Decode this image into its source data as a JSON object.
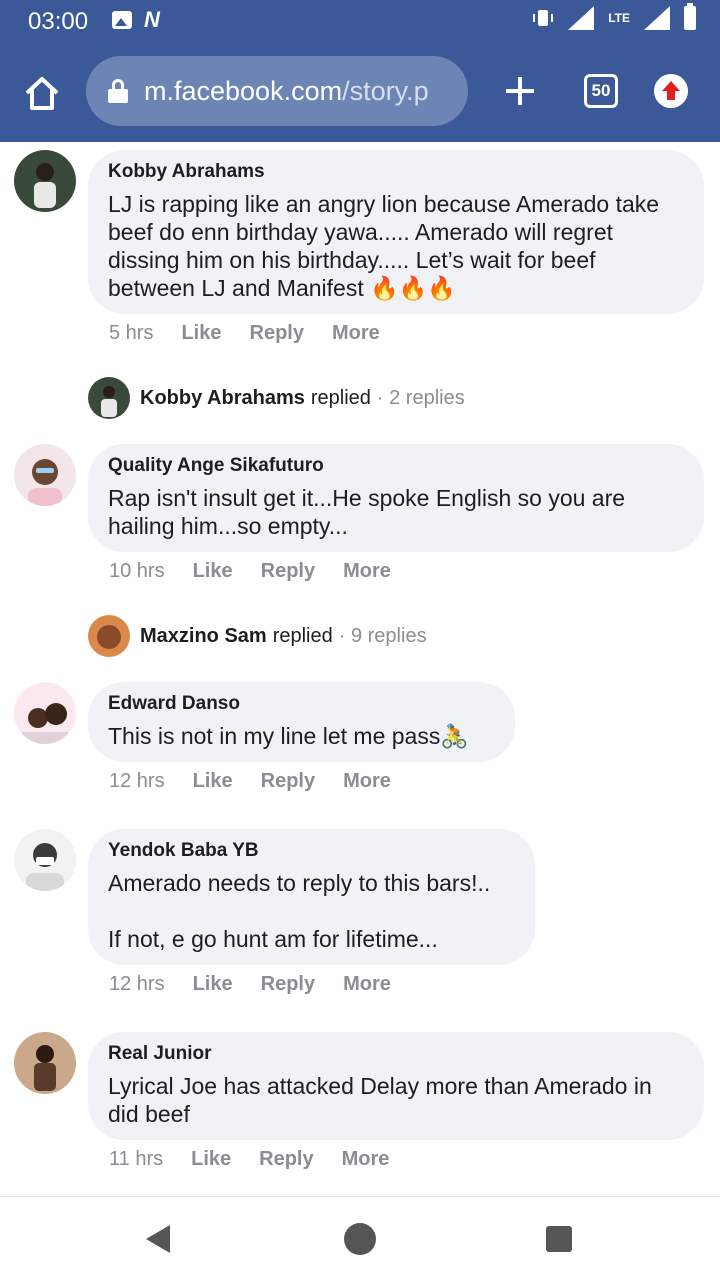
{
  "status": {
    "time": "03:00",
    "network": "LTE"
  },
  "browser": {
    "url_main": "m.facebook.com",
    "url_path": "/story.p",
    "tab_count": "50"
  },
  "comments": [
    {
      "author": "Kobby Abrahams",
      "text": "LJ is rapping like an angry lion because Amerado take beef do enn birthday yawa..... Amerado will regret dissing him on his birthday..... Let’s wait for beef between LJ and Manifest 🔥🔥🔥",
      "time": "5 hrs",
      "replied": {
        "author": "Kobby Abrahams",
        "verb": "replied",
        "count": "· 2 replies"
      }
    },
    {
      "author": "Quality Ange Sikafuturo",
      "text": "Rap isn't insult get it...He spoke English so you are hailing him...so empty...",
      "time": "10 hrs",
      "replied": {
        "author": "Maxzino Sam",
        "verb": "replied",
        "count": "· 9 replies"
      }
    },
    {
      "author": "Edward Danso",
      "text": "This is not in my line let me pass🚴",
      "time": "12 hrs"
    },
    {
      "author": "Yendok Baba YB",
      "text": "Amerado needs to reply to this bars!..\n\nIf not, e go hunt am for lifetime...",
      "time": "12 hrs"
    },
    {
      "author": "Real Junior",
      "text": "Lyrical Joe has attacked Delay more than Amerado in did beef",
      "time": "11 hrs"
    }
  ],
  "actions": {
    "like": "Like",
    "reply": "Reply",
    "more": "More"
  },
  "colors": {
    "toolbar": "#3b5998",
    "bubble": "#f0f2f5",
    "meta": "#8a8d91"
  }
}
